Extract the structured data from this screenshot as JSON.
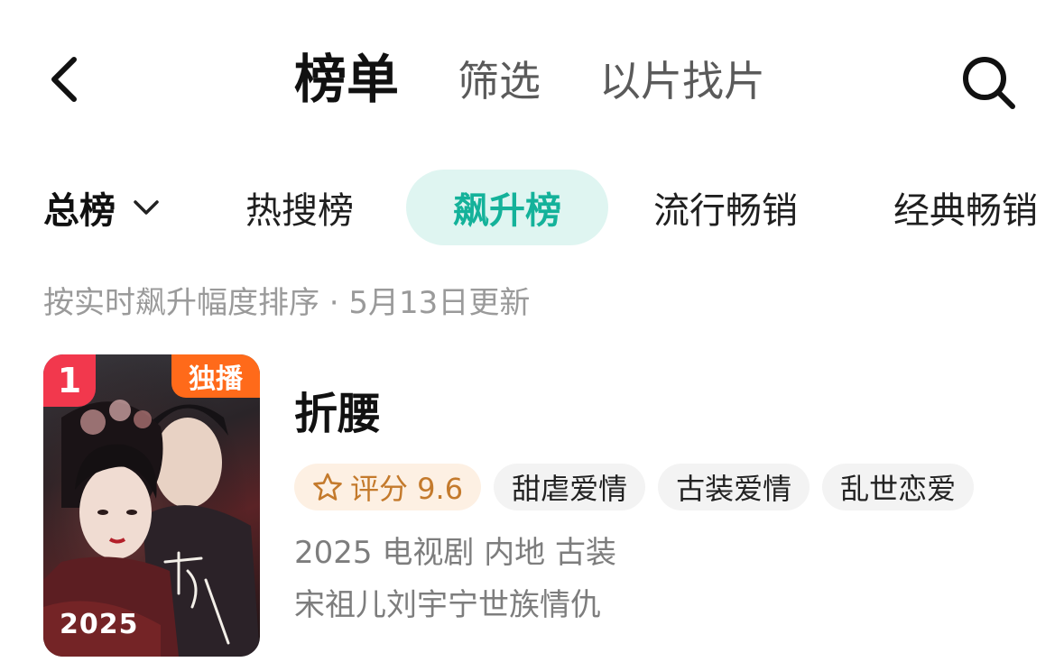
{
  "header": {
    "title": "榜单",
    "tabs": [
      {
        "label": "筛选"
      },
      {
        "label": "以片找片"
      }
    ],
    "back_icon": "back-icon",
    "search_icon": "search-icon"
  },
  "category_tabs": {
    "total": "总榜",
    "hot_search": "热搜榜",
    "rising": "飙升榜",
    "popular": "流行畅销",
    "classic": "经典畅销",
    "active_color": "#14b29a",
    "active_bg": "#dff5f1"
  },
  "subtitle": "按实时飙升幅度排序 · 5月13日更新",
  "items": [
    {
      "rank": "1",
      "exclusive": "独播",
      "poster_year": "2025",
      "title": "折腰",
      "rating_label": "评分 9.6",
      "tags": [
        "甜虐爱情",
        "古装爱情",
        "乱世恋爱"
      ],
      "meta": "2025 电视剧 内地 古装",
      "description": "宋祖儿刘宇宁世族情仇"
    }
  ],
  "colors": {
    "rank_badge": "#f2384d",
    "exclusive_badge": "#ff6a1a",
    "rating_text": "#c47a2c",
    "rating_bg": "#fdf0e3"
  }
}
